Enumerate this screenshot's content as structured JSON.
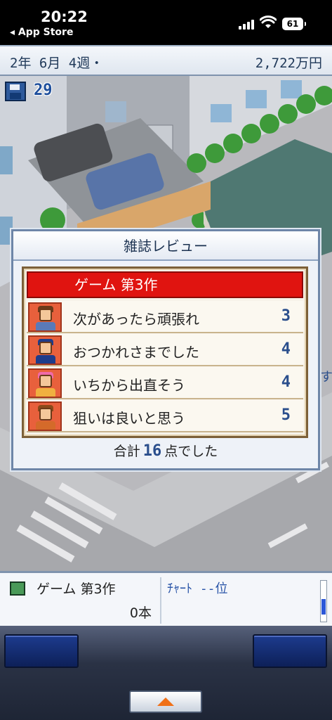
{
  "status_bar": {
    "time": "20:22",
    "back_label": "◂ App Store",
    "battery": "61"
  },
  "top_bar": {
    "date": "2年 6月 4週・",
    "money": "2,722万円"
  },
  "scene": {
    "save_count": "29",
    "save_icon": "floppy-disk-icon",
    "partial_text": "す"
  },
  "dialog": {
    "title": "雑誌レビュー",
    "game_title": "ゲーム 第3作",
    "reviews": [
      {
        "comment": "次があったら頑張れ",
        "score": "3",
        "portrait": {
          "hair": "#6a3a1a",
          "body": "#5a7ab8"
        }
      },
      {
        "comment": "おつかれさまでした",
        "score": "4",
        "portrait": {
          "hair": "#1e3c8a",
          "body": "#1e3c8a"
        }
      },
      {
        "comment": "いちから出直そう",
        "score": "4",
        "portrait": {
          "hair": "#f06aa8",
          "body": "#f0b040"
        }
      },
      {
        "comment": "狙いは良いと思う",
        "score": "5",
        "portrait": {
          "hair": "#8a4a1a",
          "body": "#d46a2a"
        }
      }
    ],
    "total_prefix": "合計",
    "total_value": "16",
    "total_suffix": "点でした"
  },
  "info_panel": {
    "game_title": "ゲーム 第3作",
    "units": "0本",
    "chart_label": "ﾁｬｰﾄ --位"
  },
  "colors": {
    "header_red": "#e01410",
    "score_blue": "#2a4e8c",
    "panel_border": "#6e86a8",
    "review_box_border": "#7c6038",
    "portrait_bg": "#e8603c"
  }
}
